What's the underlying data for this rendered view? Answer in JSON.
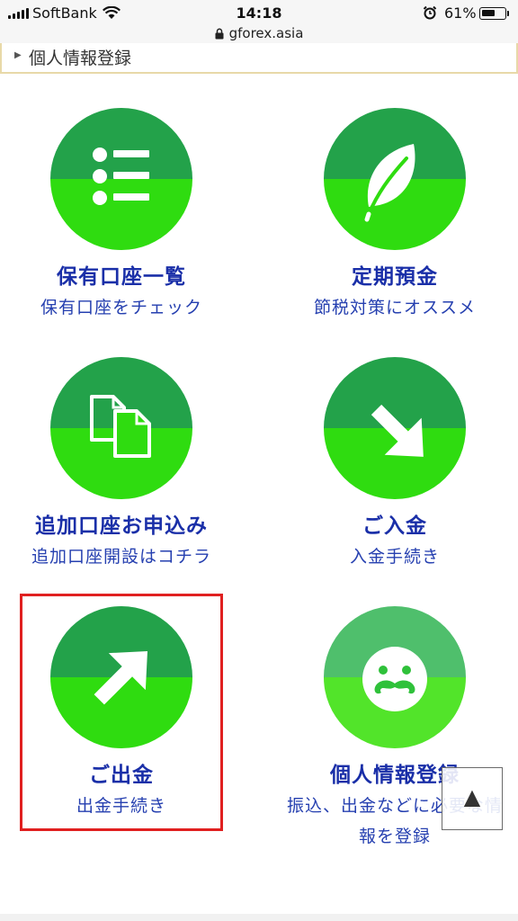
{
  "status_bar": {
    "carrier": "SoftBank",
    "time": "14:18",
    "battery": "61%",
    "battery_level": 0.61,
    "url": "gforex.asia"
  },
  "breadcrumb": {
    "label": "個人情報登録"
  },
  "menu": [
    {
      "title": "保有口座一覧",
      "subtitle": "保有口座をチェック",
      "icon": "list-icon"
    },
    {
      "title": "定期預金",
      "subtitle": "節税対策にオススメ",
      "icon": "leaf-icon"
    },
    {
      "title": "追加口座お申込み",
      "subtitle": "追加口座開設はコチラ",
      "icon": "documents-icon"
    },
    {
      "title": "ご入金",
      "subtitle": "入金手続き",
      "icon": "arrow-down-left-icon"
    },
    {
      "title": "ご出金",
      "subtitle": "出金手続き",
      "icon": "arrow-up-right-icon"
    },
    {
      "title": "個人情報登録",
      "subtitle_line1": "振込、出金などに必要な情",
      "subtitle_line2": "報を登録",
      "icon": "mustache-face-icon"
    }
  ],
  "colors": {
    "circle_top": "#23a24a",
    "circle_bottom": "#2fdc10",
    "profile_top": "#4fbf6c",
    "profile_bottom": "#52e42a",
    "title_text": "#1a2fa8",
    "highlight": "#e02020"
  },
  "scroll_top_button": {
    "symbol": "▲"
  }
}
